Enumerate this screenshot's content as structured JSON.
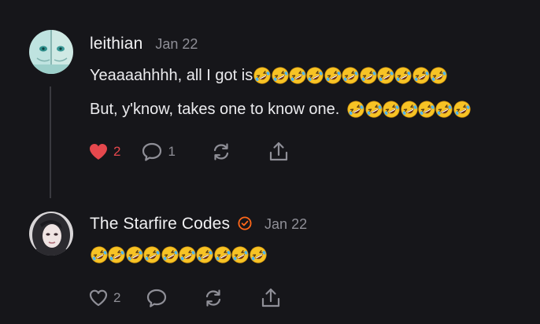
{
  "comments": [
    {
      "author": "leithian",
      "date": "Jan 22",
      "verified": false,
      "line1_text": "Yeaaaahhhh, all I got is",
      "line1_emoji": "rolling-on-floor-laughing",
      "line1_emoji_count": 11,
      "line2_text": "But, y'know, takes one to know one.",
      "line2_emoji": "rolling-on-floor-laughing",
      "line2_emoji_count": 7,
      "likes": "2",
      "liked": true,
      "replies": "1"
    },
    {
      "author": "The Starfire Codes",
      "date": "Jan 22",
      "verified": true,
      "body_emoji": "rolling-on-floor-laughing",
      "body_emoji_count": 10,
      "likes": "2",
      "liked": false,
      "replies": ""
    }
  ],
  "icons": {
    "like": "heart-icon",
    "reply": "speech-bubble-icon",
    "restack": "restack-icon",
    "share": "share-icon",
    "verified": "verified-badge-icon"
  },
  "colors": {
    "background": "#16161a",
    "liked": "#e5484d",
    "muted": "#8f8f97",
    "accent": "#ff6719"
  }
}
